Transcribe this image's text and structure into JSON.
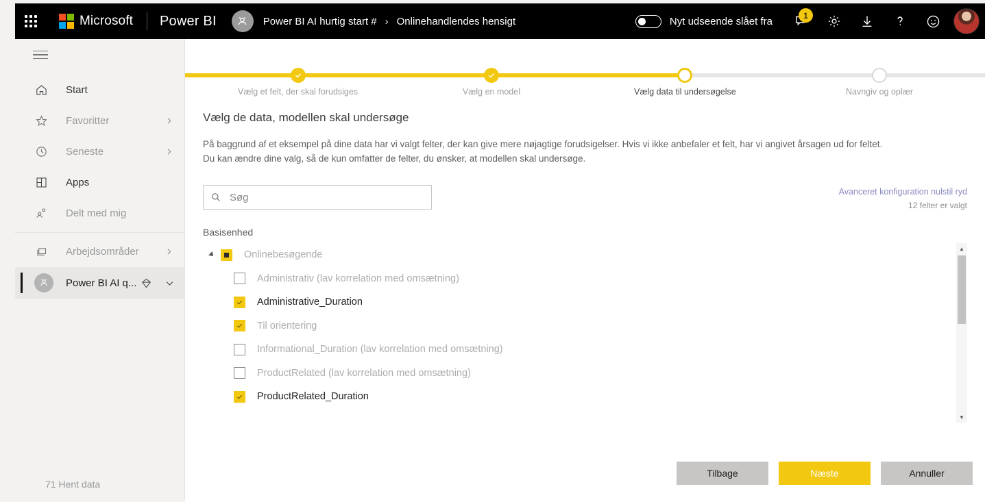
{
  "colors": {
    "accent": "#f2c811",
    "header_bg": "#000000",
    "sidebar_bg": "#f3f2f1",
    "panel_bg": "#ffffff",
    "muted_text": "#9a9a9a",
    "link": "#8a8ac0"
  },
  "header": {
    "app_launcher": "app-launcher",
    "microsoft_label": "Microsoft",
    "product_name": "Power BI",
    "breadcrumb": {
      "workspace": "Power BI AI hurtig start #",
      "separator": "›",
      "item": "Onlinehandlendes hensigt"
    },
    "new_look_toggle": {
      "label": "Nyt udseende slået fra",
      "state": "off"
    },
    "notifications_count": "1",
    "icons": {
      "notifications": "notifications-icon",
      "settings": "gear-icon",
      "download": "download-icon",
      "help": "help-icon",
      "feedback": "smiley-icon",
      "avatar": "user-avatar"
    }
  },
  "sidebar": {
    "hamburger": "hamburger-icon",
    "items": [
      {
        "label": "Start",
        "icon": "home-icon",
        "chevron": false,
        "strong": true
      },
      {
        "label": "Favoritter",
        "icon": "star-icon",
        "chevron": true,
        "strong": false
      },
      {
        "label": "Seneste",
        "icon": "clock-icon",
        "chevron": true,
        "strong": false
      },
      {
        "label": "Apps",
        "icon": "apps-icon",
        "chevron": false,
        "strong": true
      },
      {
        "label": "Delt med mig",
        "icon": "shared-icon",
        "chevron": false,
        "strong": false
      }
    ],
    "workspaces": {
      "label": "Arbejdsområder",
      "icon": "workspaces-icon",
      "chevron": true
    },
    "current_workspace": {
      "label": "Power BI AI q...",
      "avatar": "workspace-avatar",
      "premium_icon": "diamond-icon",
      "expand_icon": "chevron-down-icon"
    },
    "footer": {
      "label": "71 Hent data",
      "icon": "get-data-icon"
    }
  },
  "stepper": {
    "steps": [
      {
        "label": "Vælg et felt, der skal forudsiges",
        "state": "done",
        "pos": 14.1
      },
      {
        "label": "Vælg en model",
        "state": "done",
        "pos": 38.3
      },
      {
        "label": "Vælg data til undersøgelse",
        "state": "current",
        "pos": 62.5
      },
      {
        "label": "Navngiv og oplær",
        "state": "todo",
        "pos": 86.8
      }
    ],
    "progress_percent": 62.5
  },
  "main": {
    "title": "Vælg de data, modellen skal undersøge",
    "description_line1": "På baggrund af et eksempel på dine data har vi valgt felter, der kan give mere nøjagtige forudsigelser. Hvis vi ikke anbefaler et felt, har vi angivet årsagen ud for feltet.",
    "description_line2": "Du kan ændre dine valg, så de kun omfatter de felter, du ønsker, at modellen skal undersøge.",
    "search": {
      "placeholder": "Søg",
      "value": "",
      "icon": "search-icon"
    },
    "links": {
      "advanced": "Avanceret konfiguration",
      "reset": "nulstil",
      "clear": "ryd",
      "selection_count": "12 felter er valgt"
    },
    "list_header": "Basisenhed",
    "tree": {
      "root": {
        "label": "Onlinebesøgende",
        "checkbox_state": "indeterminate",
        "expanded": true
      },
      "children": [
        {
          "label": "Administrativ (lav korrelation med omsætning)",
          "checked": false,
          "recommended": false
        },
        {
          "label": "Administrative_Duration",
          "checked": true,
          "recommended": true
        },
        {
          "label": "Til orientering",
          "checked": true,
          "recommended": false
        },
        {
          "label": "Informational_Duration (lav korrelation med omsætning)",
          "checked": false,
          "recommended": false
        },
        {
          "label": "ProductRelated (lav korrelation med omsætning)",
          "checked": false,
          "recommended": false
        },
        {
          "label": "ProductRelated_Duration",
          "checked": true,
          "recommended": true
        }
      ]
    },
    "scrollbar": {
      "up": "▲",
      "down": "▼"
    },
    "buttons": {
      "back": "Tilbage",
      "next": "Næste",
      "cancel": "Annuller"
    }
  }
}
